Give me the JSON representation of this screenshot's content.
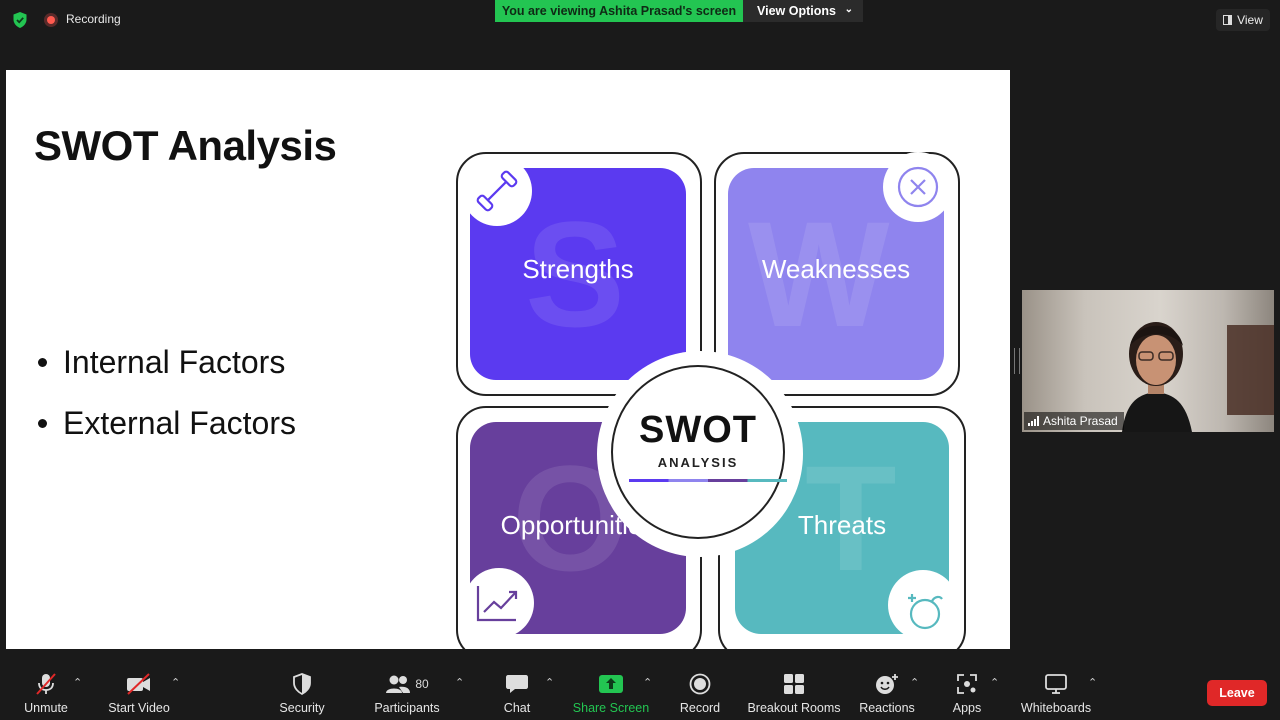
{
  "top_bar": {
    "recording_label": "Recording",
    "viewing_banner": "You are viewing Ashita Prasad's screen",
    "view_options_label": "View Options",
    "view_button_label": "View"
  },
  "slide": {
    "title": "SWOT Analysis",
    "bullets": [
      "Internal Factors",
      "External Factors"
    ],
    "diagram": {
      "quadrants": [
        {
          "label": "Strengths",
          "letter": "S",
          "color": "#5b3af0"
        },
        {
          "label": "Weaknesses",
          "letter": "W",
          "color": "#8f84ee"
        },
        {
          "label": "Opportunities",
          "letter": "O",
          "color": "#673f9c"
        },
        {
          "label": "Threats",
          "letter": "T",
          "color": "#57b9bf"
        }
      ],
      "center_title": "SWOT",
      "center_subtitle": "ANALYSIS"
    }
  },
  "participant": {
    "name": "Ashita Prasad"
  },
  "toolbar": {
    "unmute": "Unmute",
    "start_video": "Start Video",
    "security": "Security",
    "participants": "Participants",
    "participants_count": "80",
    "chat": "Chat",
    "share_screen": "Share Screen",
    "record": "Record",
    "breakout_rooms": "Breakout Rooms",
    "reactions": "Reactions",
    "apps": "Apps",
    "whiteboards": "Whiteboards",
    "leave": "Leave"
  },
  "colors": {
    "share_green": "#23c552",
    "leave_red": "#e02828",
    "recording_red": "#ff5a4f"
  }
}
